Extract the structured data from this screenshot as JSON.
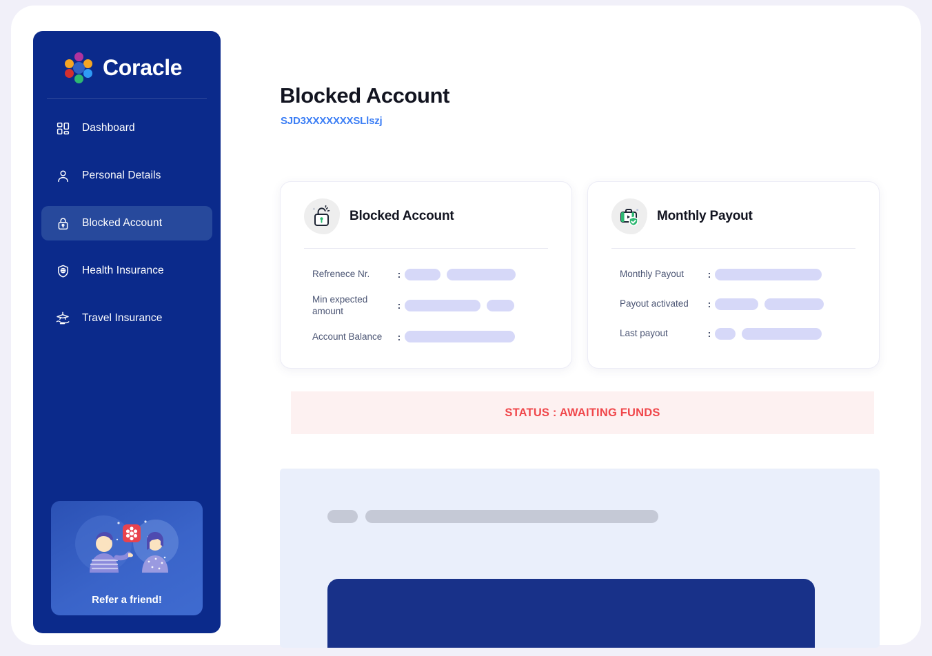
{
  "brand": {
    "name": "Coracle",
    "logo_icon": "coracle-flower-logo",
    "logo_colors": [
      "#b0339e",
      "#f5a623",
      "#d32f2f",
      "#2f9bf5",
      "#2eb872",
      "#2f62c4"
    ]
  },
  "sidebar": {
    "background_color": "#0b2a8b",
    "active_item_color": "#27499c",
    "items": [
      {
        "label": "Dashboard",
        "icon": "grid-dashboard-icon",
        "active": false
      },
      {
        "label": "Personal Details",
        "icon": "user-person-icon",
        "active": false
      },
      {
        "label": "Blocked Account",
        "icon": "padlock-locked-icon",
        "active": true
      },
      {
        "label": "Health Insurance",
        "icon": "shield-plus-icon",
        "active": false
      },
      {
        "label": "Travel Insurance",
        "icon": "airplane-hand-icon",
        "active": false
      }
    ],
    "refer_card": {
      "label": "Refer a friend!",
      "illustration": "two-people-gift-illustration"
    }
  },
  "main": {
    "page_title": "Blocked Account",
    "page_subtitle": "SJD3XXXXXXXSLlszj",
    "subtitle_color": "#3d7ff5",
    "cards": [
      {
        "title": "Blocked Account",
        "icon": "open-padlock-icon",
        "rows": [
          {
            "key": "Refrenece Nr.",
            "colon": ":",
            "value_loading": true,
            "pill_widths": [
              52,
              100
            ]
          },
          {
            "key": "Min expected amount",
            "colon": ":",
            "value_loading": true,
            "pill_widths": [
              110,
              40
            ]
          },
          {
            "key": "Account Balance",
            "colon": ":",
            "value_loading": true,
            "pill_widths": [
              160
            ]
          }
        ]
      },
      {
        "title": "Monthly Payout",
        "icon": "briefcase-shield-check-icon",
        "rows": [
          {
            "key": "Monthly Payout",
            "colon": ":",
            "value_loading": true,
            "pill_widths": [
              155
            ]
          },
          {
            "key": "Payout activated",
            "colon": ":",
            "value_loading": true,
            "pill_widths": [
              63,
              86
            ]
          },
          {
            "key": "Last payout",
            "colon": ":",
            "value_loading": true,
            "pill_widths": [
              30,
              116
            ]
          }
        ]
      }
    ],
    "status_banner": {
      "text": "STATUS : AWAITING FUNDS",
      "text_color": "#f0474b",
      "background_color": "#fdf1f1"
    },
    "bottom_panel": {
      "background_color": "#eaeffb",
      "loading": true,
      "skeleton_pill_widths": [
        44,
        425
      ],
      "block_color": "#183189"
    }
  }
}
